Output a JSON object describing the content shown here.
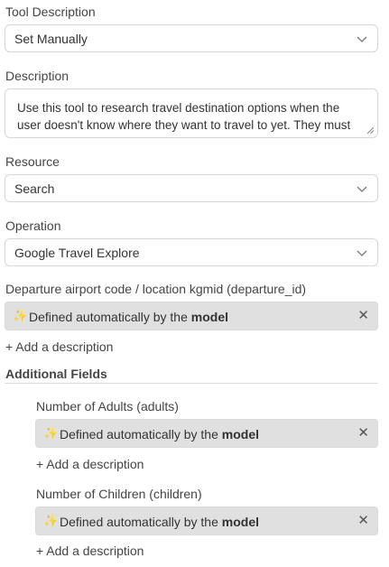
{
  "tool_description": {
    "label": "Tool Description",
    "value": "Set Manually"
  },
  "description": {
    "label": "Description",
    "value": "Use this tool to research travel destination options when the user doesn't know where they want to travel to yet. They must provide the intended f… departure location. The charts and set …"
  },
  "resource": {
    "label": "Resource",
    "value": "Search"
  },
  "operation": {
    "label": "Operation",
    "value": "Google Travel Explore"
  },
  "departure": {
    "label": "Departure airport code / location kgmid (departure_id)",
    "auto_text": "Defined automatically by the",
    "auto_bold": "model",
    "add_description": "+ Add a description"
  },
  "additional_fields": {
    "title": "Additional Fields",
    "adults": {
      "label": "Number of Adults (adults)",
      "auto_text": "Defined automatically by the",
      "auto_bold": "model",
      "add_description": "+ Add a description"
    },
    "children": {
      "label": "Number of Children (children)",
      "auto_text": "Defined automatically by the",
      "auto_bold": "model",
      "add_description": "+ Add a description"
    }
  },
  "icons": {
    "sparkle": "sparkle-icon",
    "close": "close-icon",
    "chevron": "chevron-down-icon"
  },
  "colors": {
    "field_border": "#d6d6d6",
    "auto_bg": "#e0e0e0",
    "text": "#333333"
  }
}
